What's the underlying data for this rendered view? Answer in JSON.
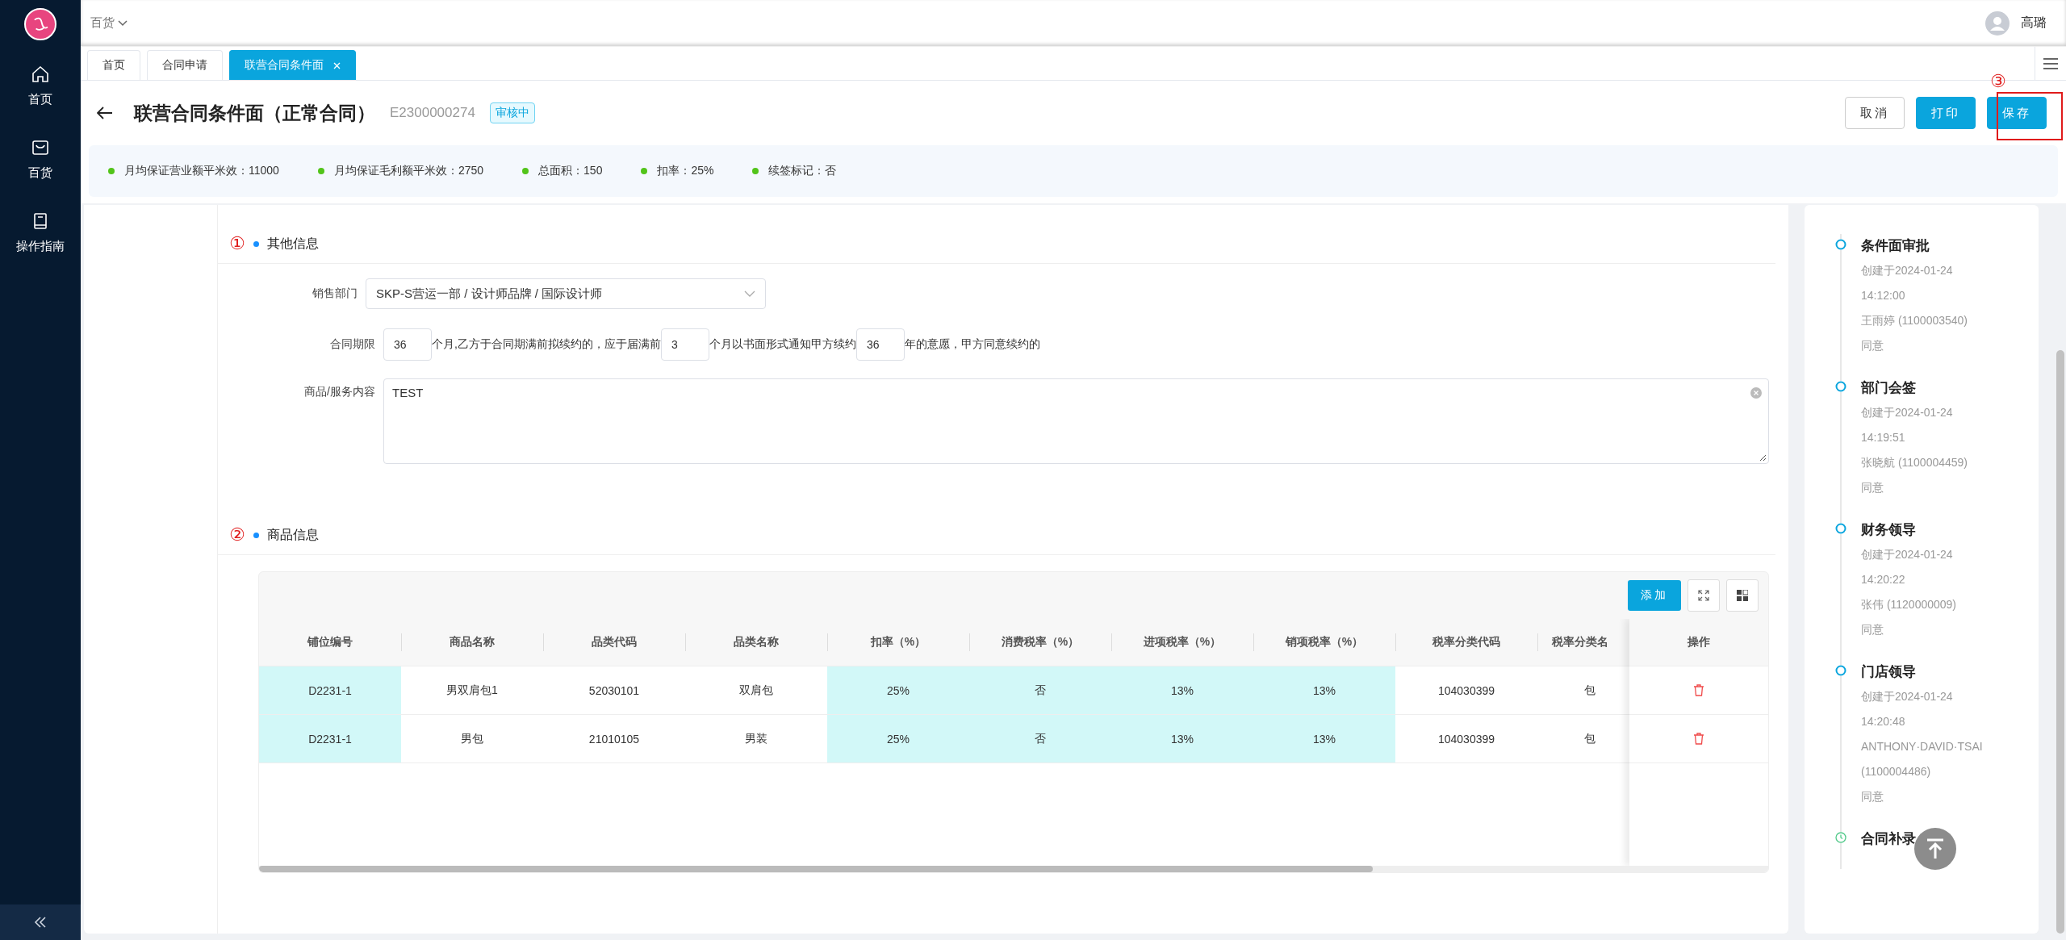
{
  "sidebar": {
    "items": [
      {
        "label": "首页"
      },
      {
        "label": "百货"
      },
      {
        "label": "操作指南"
      }
    ]
  },
  "header": {
    "menu": "百货",
    "user": "高璐"
  },
  "tabs": [
    {
      "label": "首页",
      "selected": false
    },
    {
      "label": "合同申请",
      "selected": false
    },
    {
      "label": "联营合同条件面",
      "selected": true
    }
  ],
  "title": {
    "text": "联营合同条件面（正常合同）",
    "code": "E2300000274",
    "status": "审核中"
  },
  "actions": [
    {
      "label": "取消",
      "kind": "default"
    },
    {
      "label": "打印",
      "kind": "primary"
    },
    {
      "label": "保存",
      "kind": "primary",
      "annotation": "③"
    }
  ],
  "summary": [
    "月均保证营业额平米效：11000",
    "月均保证毛利额平米效：2750",
    "总面积：150",
    "扣率：25%",
    "续签标记：否"
  ],
  "sections": [
    {
      "annotation": "①",
      "title": "其他信息"
    },
    {
      "annotation": "②",
      "title": "商品信息"
    }
  ],
  "form": {
    "department": {
      "label": "销售部门",
      "value": "SKP-S营运一部 / 设计师品牌 / 国际设计师"
    },
    "term": {
      "label": "合同期限",
      "parts": [
        {
          "kind": "input",
          "value": "36"
        },
        {
          "kind": "text",
          "text": "个月,乙方于合同期满前拟续约的，应于届满前"
        },
        {
          "kind": "input",
          "value": "3"
        },
        {
          "kind": "text",
          "text": "个月以书面形式通知甲方续约"
        },
        {
          "kind": "input",
          "value": "36"
        },
        {
          "kind": "text",
          "text": "年的意愿，甲方同意续约的"
        }
      ]
    },
    "content": {
      "label": "商品/服务内容",
      "value": "TEST"
    }
  },
  "goods_table": {
    "add_button": "添加",
    "action_column": "操作",
    "columns": [
      {
        "label": "铺位编号",
        "highlighted": true
      },
      {
        "label": "商品名称",
        "highlighted": false
      },
      {
        "label": "品类代码",
        "highlighted": false
      },
      {
        "label": "品类名称",
        "highlighted": false
      },
      {
        "label": "扣率（%）",
        "highlighted": true
      },
      {
        "label": "消费税率（%）",
        "highlighted": true
      },
      {
        "label": "进项税率（%）",
        "highlighted": true
      },
      {
        "label": "销项税率（%）",
        "highlighted": true
      },
      {
        "label": "税率分类代码",
        "highlighted": false
      },
      {
        "label": "税率分类名",
        "highlighted": false
      }
    ],
    "rows": [
      [
        "D2231-1",
        "男双肩包1",
        "52030101",
        "双肩包",
        "25%",
        "否",
        "13%",
        "13%",
        "104030399",
        "包"
      ],
      [
        "D2231-1",
        "男包",
        "21010105",
        "男装",
        "25%",
        "否",
        "13%",
        "13%",
        "104030399",
        "包"
      ]
    ]
  },
  "timeline": [
    {
      "kind": "done",
      "title": "条件面审批",
      "created": "创建于2024-01-24",
      "time": "14:12:00",
      "approver": "王雨婷 (1100003540)",
      "result": "同意"
    },
    {
      "kind": "done",
      "title": "部门会签",
      "created": "创建于2024-01-24",
      "time": "14:19:51",
      "approver": "张晓航 (1100004459)",
      "result": "同意"
    },
    {
      "kind": "done",
      "title": "财务领导",
      "created": "创建于2024-01-24",
      "time": "14:20:22",
      "approver": "张伟 (1120000009)",
      "result": "同意"
    },
    {
      "kind": "done",
      "title": "门店领导",
      "created": "创建于2024-01-24",
      "time": "14:20:48",
      "approver": "ANTHONY·DAVID·TSAI (1100004486)",
      "result": "同意"
    },
    {
      "kind": "pending",
      "title": "合同补录"
    }
  ]
}
